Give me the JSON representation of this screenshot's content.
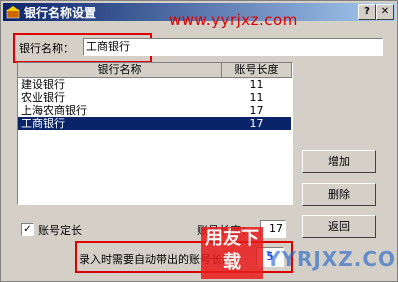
{
  "window": {
    "title": "银行名称设置",
    "watermark": "www.yyrjxz.com",
    "help_glyph": "?",
    "close_glyph": "✕"
  },
  "form": {
    "name_label": "银行名称",
    "name_value": "工商银行"
  },
  "list": {
    "headers": [
      "银行名称",
      "账号长度"
    ],
    "rows": [
      {
        "name": "建设银行",
        "len": "11"
      },
      {
        "name": "农业银行",
        "len": "11"
      },
      {
        "name": "上海农商银行",
        "len": "17"
      },
      {
        "name": "工商银行",
        "len": "17"
      }
    ],
    "selected_index": 3
  },
  "buttons": {
    "add": "增加",
    "delete": "删除",
    "back": "返回"
  },
  "fixed_length": {
    "checked": true,
    "label": "账号定长",
    "length_label": "账号长度",
    "length_value": "17"
  },
  "auto": {
    "label": "录入时需要自动带出的账号长度",
    "value": "5"
  },
  "watermark2": {
    "text": "用友下载",
    "site": "YYRJXZ.COM"
  }
}
